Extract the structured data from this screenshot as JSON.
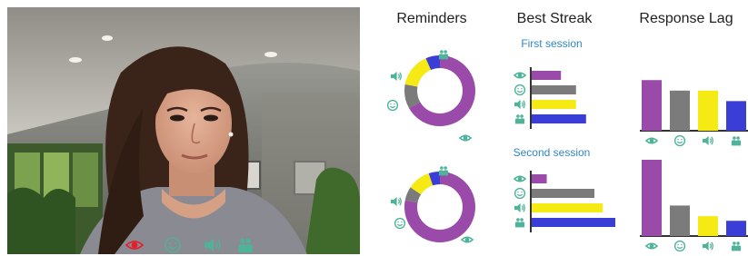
{
  "colors": {
    "purple": "#9a4aa8",
    "gray": "#7b7b7b",
    "yellow": "#f5ea13",
    "blue": "#3a3ed6",
    "teal": "#4fb39a",
    "session_label": "#2f86c8",
    "highlight_red": "#e0202a"
  },
  "video_overlay": {
    "icons": [
      {
        "name": "eye-icon",
        "active": true
      },
      {
        "name": "smile-icon",
        "active": false
      },
      {
        "name": "speaker-icon",
        "active": false
      },
      {
        "name": "group-icon",
        "active": false
      }
    ]
  },
  "reminders": {
    "title": "Reminders",
    "first": {
      "segments": [
        {
          "metric": "eye",
          "fraction": 0.6,
          "color": "purple"
        },
        {
          "metric": "smile",
          "fraction": 0.1,
          "color": "gray"
        },
        {
          "metric": "speaker",
          "fraction": 0.14,
          "color": "yellow"
        },
        {
          "metric": "group",
          "fraction": 0.06,
          "color": "blue"
        }
      ]
    },
    "second": {
      "segments": [
        {
          "metric": "eye",
          "fraction": 0.74,
          "color": "purple"
        },
        {
          "metric": "smile",
          "fraction": 0.06,
          "color": "gray"
        },
        {
          "metric": "speaker",
          "fraction": 0.1,
          "color": "yellow"
        },
        {
          "metric": "group",
          "fraction": 0.05,
          "color": "blue"
        }
      ]
    }
  },
  "best_streak": {
    "title": "Best Streak",
    "first_label": "First session",
    "second_label": "Second session",
    "first": [
      {
        "metric": "eye",
        "value": 35,
        "color": "purple"
      },
      {
        "metric": "smile",
        "value": 53,
        "color": "gray"
      },
      {
        "metric": "speaker",
        "value": 53,
        "color": "yellow"
      },
      {
        "metric": "group",
        "value": 65,
        "color": "blue"
      }
    ],
    "second": [
      {
        "metric": "eye",
        "value": 18,
        "color": "purple"
      },
      {
        "metric": "smile",
        "value": 75,
        "color": "gray"
      },
      {
        "metric": "speaker",
        "value": 85,
        "color": "yellow"
      },
      {
        "metric": "group",
        "value": 100,
        "color": "blue"
      }
    ]
  },
  "response_lag": {
    "title": "Response Lag",
    "first": [
      {
        "metric": "eye",
        "value": 82,
        "color": "purple"
      },
      {
        "metric": "smile",
        "value": 65,
        "color": "gray"
      },
      {
        "metric": "speaker",
        "value": 65,
        "color": "yellow"
      },
      {
        "metric": "group",
        "value": 48,
        "color": "blue"
      }
    ],
    "second": [
      {
        "metric": "eye",
        "value": 100,
        "color": "purple"
      },
      {
        "metric": "smile",
        "value": 40,
        "color": "gray"
      },
      {
        "metric": "speaker",
        "value": 26,
        "color": "yellow"
      },
      {
        "metric": "group",
        "value": 20,
        "color": "blue"
      }
    ]
  }
}
